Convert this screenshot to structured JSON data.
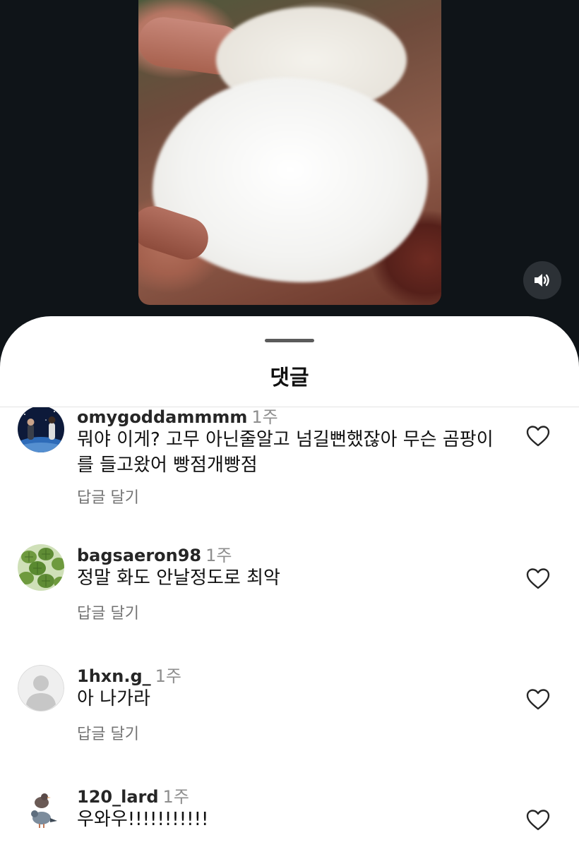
{
  "sheet": {
    "title": "댓글"
  },
  "comments": [
    {
      "username": "omygoddammmm",
      "time": "1주",
      "text": "뭐야 이게? 고무 아닌줄알고 넘길뻔했잖아 무슨 곰팡이를 들고왔어 빵점개빵점",
      "reply_label": "답글 달기",
      "avatar_icon": "space-photo-avatar"
    },
    {
      "username": "bagsaeron98",
      "time": "1주",
      "text": "정말 화도 안날정도로 최악",
      "reply_label": "답글 달기",
      "avatar_icon": "turtle-photo-avatar"
    },
    {
      "username": "1hxn.g_",
      "time": "1주",
      "text": "아 나가라",
      "reply_label": "답글 달기",
      "avatar_icon": "default-user-avatar"
    },
    {
      "username": "120_lard",
      "time": "1주",
      "text": "우와우!!!!!!!!!!!",
      "reply_label": "",
      "avatar_icon": "pigeon-photo-avatar"
    }
  ],
  "icons": {
    "speaker": "speaker-on-icon",
    "heart": "heart-outline-icon"
  },
  "colors": {
    "background_dark": "#0f1418",
    "sheet_background": "#ffffff",
    "muted_text": "#737373"
  }
}
